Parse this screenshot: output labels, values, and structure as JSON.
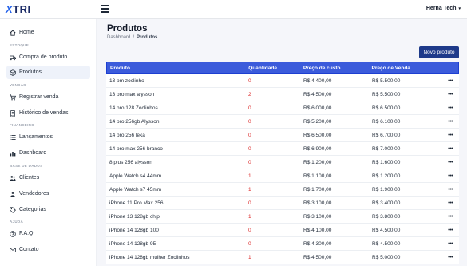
{
  "brand": {
    "logo_prefix": "X",
    "logo_text": "TRI"
  },
  "header": {
    "user_name": "Herna Tech",
    "caret": "▾"
  },
  "sidebar": {
    "items": [
      {
        "label": "Home",
        "icon": "home-icon"
      },
      {
        "label": "Compra de produto",
        "icon": "truck-icon"
      },
      {
        "label": "Produtos",
        "icon": "box-icon"
      },
      {
        "label": "Registrar venda",
        "icon": "cart-icon"
      },
      {
        "label": "Histórico de vendas",
        "icon": "receipt-icon"
      },
      {
        "label": "Lançamentos",
        "icon": "list-icon"
      },
      {
        "label": "Dashboard",
        "icon": "chart-icon"
      },
      {
        "label": "Clientes",
        "icon": "users-icon"
      },
      {
        "label": "Vendedores",
        "icon": "user-group-icon"
      },
      {
        "label": "Categorias",
        "icon": "tag-icon"
      },
      {
        "label": "F.A.Q",
        "icon": "question-icon"
      },
      {
        "label": "Contato",
        "icon": "mail-icon"
      }
    ],
    "sections": [
      "ESTOQUE",
      "VENDAS",
      "FINANCEIRO",
      "BASE DE DADOS",
      "AJUDA"
    ]
  },
  "page": {
    "title": "Produtos",
    "breadcrumb": {
      "root": "Dashboard",
      "separator": "/",
      "current": "Produtos"
    },
    "new_button": "Novo produto"
  },
  "table": {
    "headers": [
      "Produto",
      "Quantidade",
      "Preço de custo",
      "Preço de Venda"
    ],
    "action_glyph": "•••",
    "rows": [
      [
        "13 pm zoclinho",
        "0",
        "R$ 4.400,00",
        "R$ 5.500,00"
      ],
      [
        "13 pro max alysson",
        "2",
        "R$ 4.500,00",
        "R$ 5.500,00"
      ],
      [
        "14 pro 128 Zoclinhos",
        "0",
        "R$ 6.000,00",
        "R$ 6.500,00"
      ],
      [
        "14 pro 256gb Alysson",
        "0",
        "R$ 5.200,00",
        "R$ 6.100,00"
      ],
      [
        "14 pro 256 leka",
        "0",
        "R$ 6.500,00",
        "R$ 6.700,00"
      ],
      [
        "14 pro max 256 branco",
        "0",
        "R$ 6.900,00",
        "R$ 7.000,00"
      ],
      [
        "8 plus 256 alysson",
        "0",
        "R$ 1.200,00",
        "R$ 1.600,00"
      ],
      [
        "Apple Watch s4 44mm",
        "1",
        "R$ 1.100,00",
        "R$ 1.200,00"
      ],
      [
        "Apple Watch s7 45mm",
        "1",
        "R$ 1.700,00",
        "R$ 1.900,00"
      ],
      [
        "iPhone 11 Pro Max 256",
        "0",
        "R$ 3.100,00",
        "R$ 3.400,00"
      ],
      [
        "iPhone 13 128gb chip",
        "1",
        "R$ 3.100,00",
        "R$ 3.800,00"
      ],
      [
        "iPhone 14 128gb 100",
        "0",
        "R$ 4.100,00",
        "R$ 4.500,00"
      ],
      [
        "iPhone 14 128gb 95",
        "0",
        "R$ 4.300,00",
        "R$ 4.500,00"
      ],
      [
        "iPhone 14 128gb mulher Zoclinhos",
        "1",
        "R$ 4.500,00",
        "R$ 5.000,00"
      ]
    ]
  }
}
